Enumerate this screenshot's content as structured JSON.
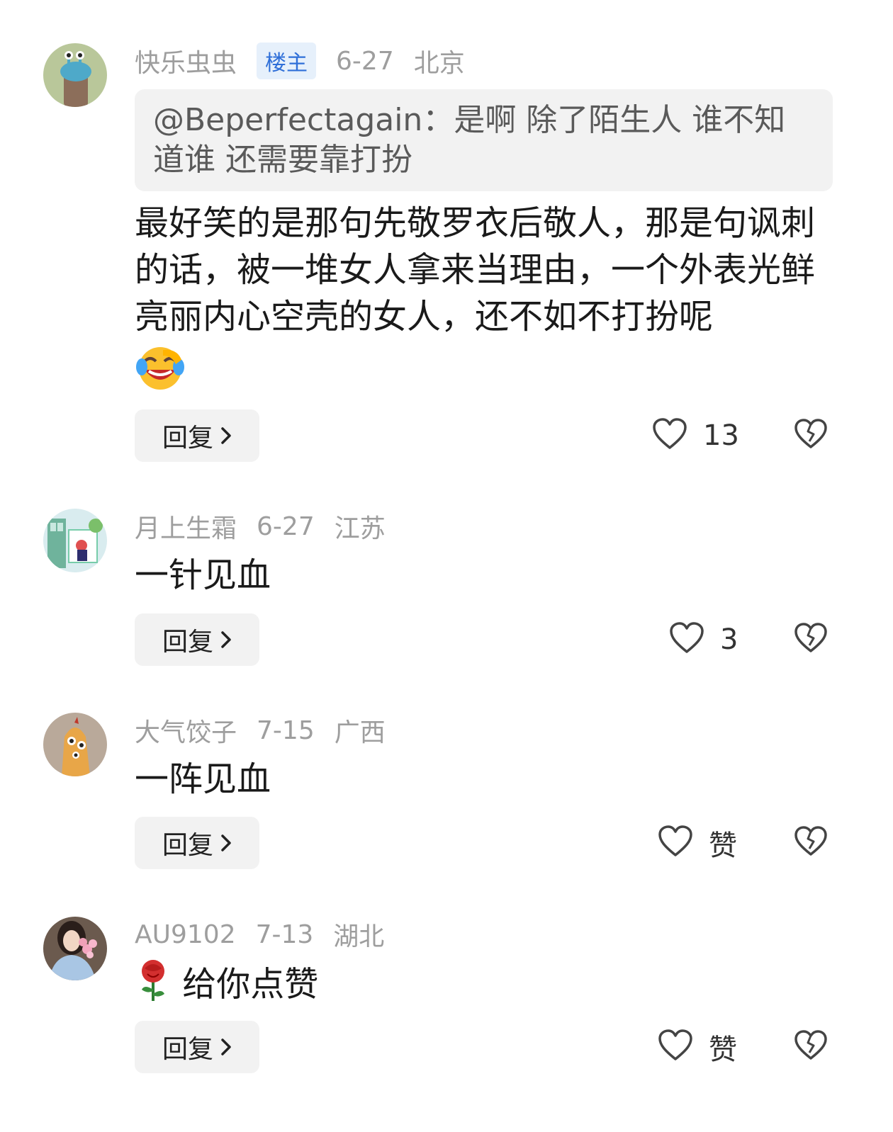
{
  "comments": [
    {
      "username": "快乐虫虫",
      "badge": "楼主",
      "date": "6-27",
      "location": "北京",
      "quote": "@Beperfectagain：是啊 除了陌生人 谁不知道谁 还需要靠打扮",
      "text": "最好笑的是那句先敬罗衣后敬人，那是句讽刺的话，被一堆女人拿来当理由，一个外表光鲜亮丽内心空壳的女人，还不如不打扮呢",
      "emoji": "rolling-on-floor-laughing",
      "reply_label": "回复",
      "like_count": "13",
      "avatar_icon": "green-bug-avatar"
    },
    {
      "username": "月上生霜",
      "date": "6-27",
      "location": "江苏",
      "text": "一针见血",
      "reply_label": "回复",
      "like_count": "3",
      "avatar_icon": "illustrated-window-avatar"
    },
    {
      "username": "大气饺子",
      "date": "7-15",
      "location": "广西",
      "text": "一阵见血",
      "reply_label": "回复",
      "like_count": "赞",
      "avatar_icon": "cartoon-dumpling-avatar"
    },
    {
      "username": "AU9102",
      "date": "7-13",
      "location": "湖北",
      "emoji": "rose",
      "text": "给你点赞",
      "reply_label": "回复",
      "like_count": "赞",
      "avatar_icon": "girl-with-flowers-avatar"
    }
  ],
  "colors": {
    "meta_text": "#9e9e9e",
    "badge_bg": "#e6f0fb",
    "badge_text": "#2f6fd8",
    "button_bg": "#f2f2f2"
  }
}
